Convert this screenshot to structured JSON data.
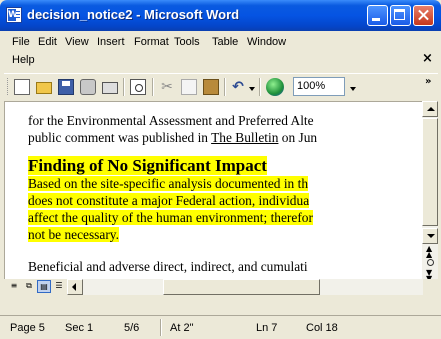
{
  "window": {
    "title": "decision_notice2 - Microsoft Word"
  },
  "menu": [
    "File",
    "Edit",
    "View",
    "Insert",
    "Format",
    "Tools",
    "Table",
    "Window",
    "Help"
  ],
  "doc_close_glyph": "×",
  "toolbar": {
    "icons": [
      "new-document-icon",
      "open-folder-icon",
      "save-icon",
      "permission-icon",
      "print-icon",
      "print-preview-icon",
      "cut-icon",
      "copy-icon",
      "paste-icon",
      "undo-icon",
      "web-toolbar-icon"
    ],
    "zoom": "100%",
    "overflow_glyph": "»"
  },
  "document": {
    "line1": "for the Environmental Assessment and Preferred Alte",
    "line2_pre": "public comment was published in ",
    "line2_link": "The Bulletin",
    "line2_post": " on Jun",
    "heading": "Finding of No Significant Impact",
    "hl_lines": [
      "Based on the site-specific analysis documented in th",
      "does not constitute a major Federal action, individua",
      "affect the quality of the human environment; therefor",
      "not be necessary."
    ],
    "line_last": "Beneficial and adverse direct, indirect, and cumulati"
  },
  "highlight_color": "#ffff00",
  "status": {
    "page": "Page 5",
    "sec": "Sec 1",
    "pos": "5/6",
    "at": "At 2\"",
    "ln": "Ln 7",
    "col": "Col 18"
  }
}
